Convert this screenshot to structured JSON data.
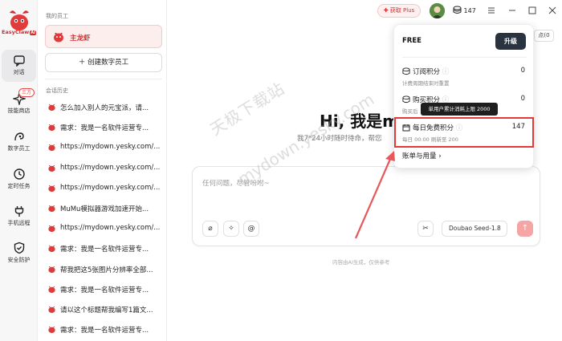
{
  "app": {
    "name": "EasyClaw",
    "logo_badge": "AI",
    "accent": "#d42b2b"
  },
  "rail": {
    "items": [
      {
        "label": "对话",
        "icon": "chat-icon"
      },
      {
        "label": "技能商店",
        "icon": "sparkle-icon",
        "badge": "三方"
      },
      {
        "label": "数字员工",
        "icon": "employee-icon"
      },
      {
        "label": "定时任务",
        "icon": "clock-icon"
      },
      {
        "label": "手机远程",
        "icon": "plug-icon"
      },
      {
        "label": "安全防护",
        "icon": "shield-icon"
      }
    ]
  },
  "sidebar": {
    "employees_title": "我的员工",
    "employee_name": "主龙虾",
    "create_label": "创建数字员工",
    "history_title": "会话历史",
    "history": [
      "怎么加入别人的元宝派，请...",
      "需求：我是一名软件运营专...",
      "https://mydown.yesky.com/...",
      "https://mydown.yesky.com/...",
      "https://mydown.yesky.com/...",
      "MuMu模拟器游戏加速开始...",
      "https://mydown.yesky.com/...",
      "需求：我是一名软件运营专...",
      "帮我把这5张图片分辨率全部...",
      "需求：我是一名软件运营专...",
      "请以这个标题帮我编写1篇文...",
      "需求：我是一名软件运营专..."
    ]
  },
  "topbar": {
    "get_plus": "获取 Plus",
    "points": "147"
  },
  "main": {
    "hero_title": "Hi, 我是m",
    "hero_sub": "我7*24小时随时待命，帮您",
    "input_placeholder": "任何问题，尽管吩咐~",
    "model": "Doubao Seed-1.8",
    "footnote": "内容由AI生成，仅供参考",
    "side_button": "点(0"
  },
  "popover": {
    "plan": "FREE",
    "upgrade": "升级",
    "rows": [
      {
        "title": "订阅积分",
        "value": "0",
        "desc": "计费周期结束时重置"
      },
      {
        "title": "购买积分",
        "value": "0",
        "desc": "购买后"
      },
      {
        "title": "每日免费积分",
        "value": "147",
        "desc": "每日 00:00 刷新至 200"
      }
    ],
    "tooltip": "单用户累计消耗上限 2000",
    "bill": "账单与用量"
  },
  "watermark": {
    "line1": "天极下载站",
    "line2": "mydown.yesky.com"
  }
}
